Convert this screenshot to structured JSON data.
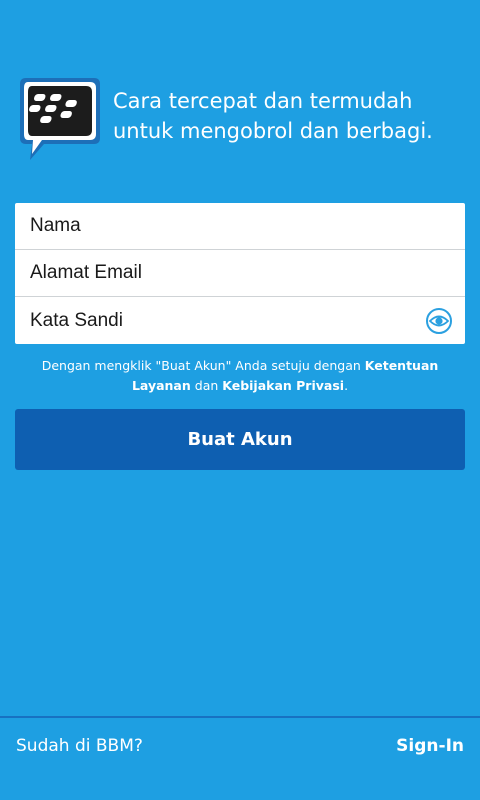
{
  "header": {
    "logo_icon": "bbm-logo-icon",
    "tagline": "Cara tercepat dan termudah untuk mengobrol dan berbagi."
  },
  "form": {
    "name_placeholder": "Nama",
    "email_placeholder": "Alamat Email",
    "password_placeholder": "Kata Sandi",
    "show_password_icon": "eye-icon"
  },
  "terms": {
    "text_before": "Dengan mengklik \"Buat Akun\" Anda setuju dengan ",
    "terms_link": "Ketentuan Layanan",
    "text_middle": " dan ",
    "privacy_link": "Kebijakan Privasi",
    "text_after": "."
  },
  "cta": {
    "label": "Buat Akun"
  },
  "footer": {
    "question": "Sudah di BBM?",
    "signin_label": "Sign-In"
  },
  "colors": {
    "background": "#1e9fe2",
    "button": "#0e5fb1",
    "accent_icon": "#2ba0e0"
  }
}
